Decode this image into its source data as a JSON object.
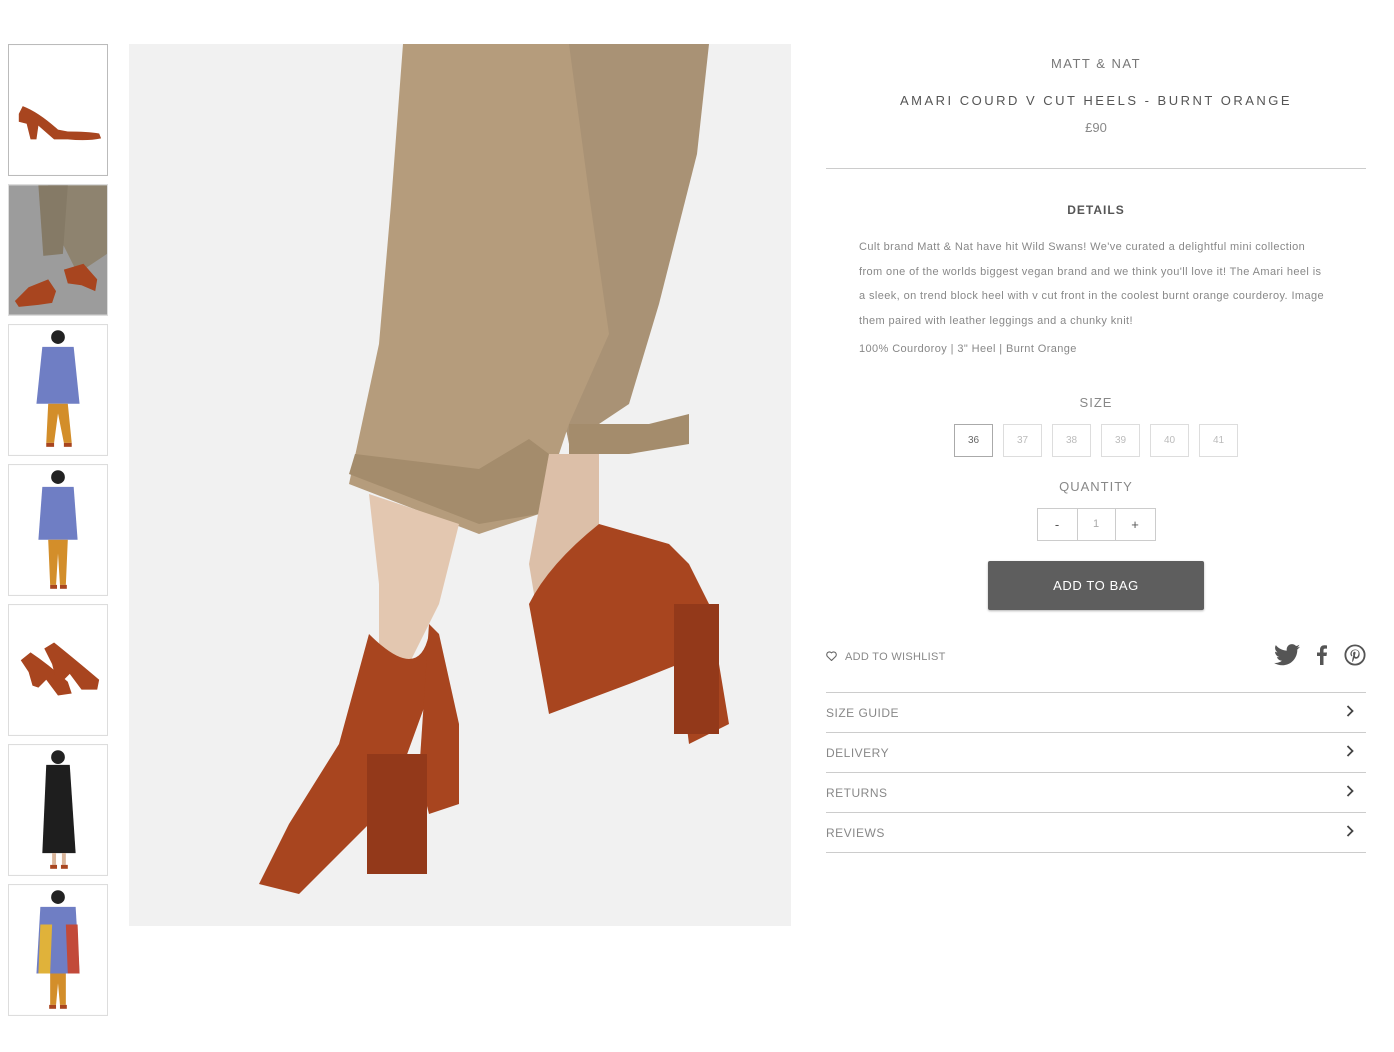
{
  "product": {
    "brand": "MATT & NAT",
    "title": "AMARI COURD V CUT HEELS - BURNT ORANGE",
    "price": "£90"
  },
  "details": {
    "heading": "DETAILS",
    "description": "Cult brand Matt & Nat have hit Wild Swans! We've curated a delightful mini collection from one of the worlds biggest vegan brand and we think you'll love it! The Amari heel is a sleek, on trend block heel with v cut front in the coolest burnt orange courderoy. Image them paired with leather leggings and a chunky knit!",
    "spec": "100% Courdoroy | 3\" Heel | Burnt Orange"
  },
  "size": {
    "heading": "SIZE",
    "options": [
      "36",
      "37",
      "38",
      "39",
      "40",
      "41"
    ],
    "selected": "36"
  },
  "quantity": {
    "heading": "QUANTITY",
    "minus": "-",
    "value": "1",
    "plus": "+"
  },
  "actions": {
    "add_to_bag": "ADD TO BAG",
    "wishlist": "ADD TO WISHLIST"
  },
  "social": {
    "icons": [
      "twitter-icon",
      "facebook-icon",
      "pinterest-icon"
    ]
  },
  "accordion": [
    {
      "label": "SIZE GUIDE"
    },
    {
      "label": "DELIVERY"
    },
    {
      "label": "RETURNS"
    },
    {
      "label": "REVIEWS"
    }
  ],
  "colors": {
    "shoe": "#a8451f",
    "trousers": "#b59c7c",
    "button": "#5e5e5e",
    "divider": "#cccccc"
  }
}
